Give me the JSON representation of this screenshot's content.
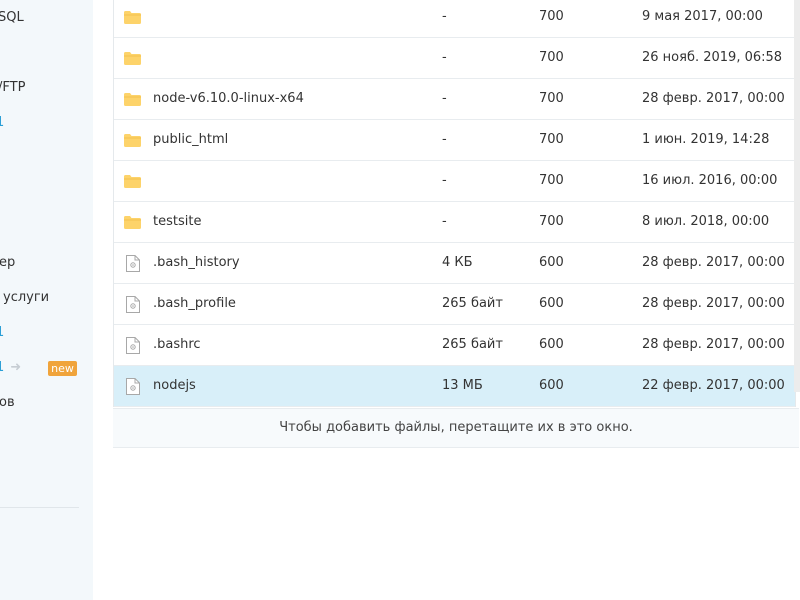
{
  "sidebar": {
    "items": [
      {
        "label": "SQL"
      },
      {
        "label": "/FTP"
      },
      {
        "label": "1"
      },
      {
        "label": "ер"
      },
      {
        "label": "услуги"
      },
      {
        "label": "1"
      },
      {
        "label": "1"
      },
      {
        "label": "ов"
      }
    ],
    "new_badge": "new"
  },
  "files": [
    {
      "name": "",
      "size": "-",
      "perm": "700",
      "date": "9 мая 2017, 00:00",
      "type": "folder"
    },
    {
      "name": "",
      "size": "-",
      "perm": "700",
      "date": "26 нояб. 2019, 06:58",
      "type": "folder"
    },
    {
      "name": "node-v6.10.0-linux-x64",
      "size": "-",
      "perm": "700",
      "date": "28 февр. 2017, 00:00",
      "type": "folder"
    },
    {
      "name": "public_html",
      "size": "-",
      "perm": "700",
      "date": "1 июн. 2019, 14:28",
      "type": "folder"
    },
    {
      "name": "",
      "size": "-",
      "perm": "700",
      "date": "16 июл. 2016, 00:00",
      "type": "folder"
    },
    {
      "name": "testsite",
      "size": "-",
      "perm": "700",
      "date": "8 июл. 2018, 00:00",
      "type": "folder"
    },
    {
      "name": ".bash_history",
      "size": "4 КБ",
      "perm": "600",
      "date": "28 февр. 2017, 00:00",
      "type": "file"
    },
    {
      "name": ".bash_profile",
      "size": "265 байт",
      "perm": "600",
      "date": "28 февр. 2017, 00:00",
      "type": "file"
    },
    {
      "name": ".bashrc",
      "size": "265 байт",
      "perm": "600",
      "date": "28 февр. 2017, 00:00",
      "type": "file"
    },
    {
      "name": "nodejs",
      "size": "13 МБ",
      "perm": "600",
      "date": "22 февр. 2017, 00:00",
      "type": "file",
      "selected": true
    }
  ],
  "drop_hint": "Чтобы добавить файлы, перетащите их в это окно.",
  "colors": {
    "sidebar_bg": "#f3f8fb",
    "accent": "#2a9fd6",
    "badge": "#f0a43b",
    "selected_row": "#d8eff9",
    "folder": "#fdd36a"
  }
}
